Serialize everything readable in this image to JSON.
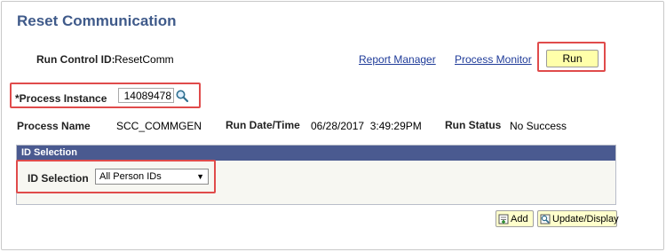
{
  "page": {
    "title": "Reset Communication"
  },
  "run_control": {
    "label": "Run Control ID:",
    "value": "ResetComm"
  },
  "links": {
    "report_manager": "Report Manager",
    "process_monitor": "Process Monitor"
  },
  "run_button": {
    "label": "Run"
  },
  "process_instance": {
    "label": "*Process Instance",
    "value": "14089478"
  },
  "process_info": {
    "name_label": "Process Name",
    "name_value": "SCC_COMMGEN",
    "date_label": "Run Date/Time",
    "date_value": "06/28/2017  3:49:29PM",
    "status_label": "Run Status",
    "status_value": "No Success"
  },
  "id_section": {
    "header": "ID Selection",
    "field_label": "ID Selection",
    "selected_value": "All Person IDs"
  },
  "toolbar": {
    "add_label": "Add",
    "update_label": "Update/Display"
  },
  "colors": {
    "title": "#3f5a8a",
    "callout": "#e04b4b",
    "run_bg": "#ffffaa",
    "section_header": "#4a5a90"
  }
}
